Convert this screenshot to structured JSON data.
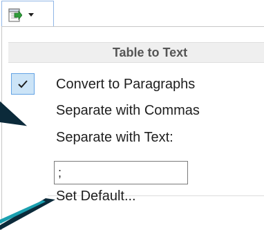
{
  "toolbar": {
    "button_icon": "table-to-text-icon",
    "dropdown_icon": "triangle-down-icon"
  },
  "menu": {
    "header": "Table to Text",
    "items": [
      {
        "label": "Convert to Paragraphs",
        "checked": true
      },
      {
        "label": "Separate with Commas",
        "checked": false
      },
      {
        "label": "Separate with Text:",
        "checked": false
      }
    ],
    "separator_value": ";",
    "set_default_label": "Set Default..."
  },
  "colors": {
    "accent": "#62a2e4",
    "check_fill": "#cce4f7",
    "header_bg": "#efefef",
    "icon_green": "#2f9d3a"
  }
}
